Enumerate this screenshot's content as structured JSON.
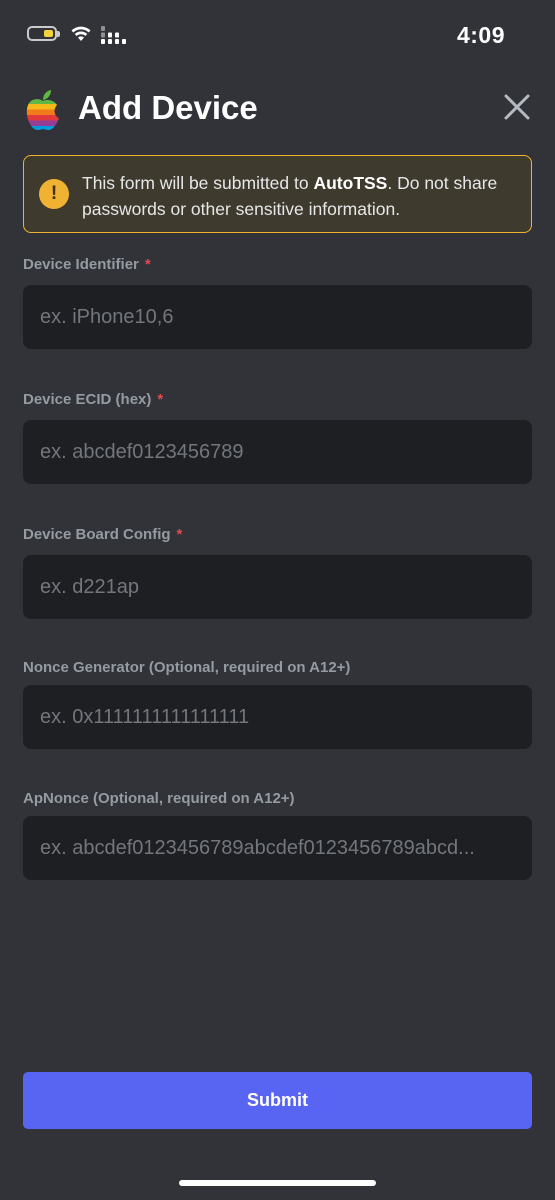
{
  "status_bar": {
    "time": "4:09",
    "battery_color": "#f2d33b"
  },
  "header": {
    "title": "Add Device",
    "logo_icon": "apple-rainbow-logo",
    "close_icon": "close-icon"
  },
  "warning": {
    "text_before": "This form will be submitted to ",
    "text_bold": "AutoTSS",
    "text_after": ". Do not share passwords or other sensitive information.",
    "icon": "exclamation-icon",
    "border_color": "#f0b232"
  },
  "fields": [
    {
      "label": "Device Identifier",
      "required_mark": "*",
      "placeholder": "ex. iPhone10,6",
      "value": ""
    },
    {
      "label": "Device ECID (hex)",
      "required_mark": "*",
      "placeholder": "ex. abcdef0123456789",
      "value": ""
    },
    {
      "label": "Device Board Config",
      "required_mark": "*",
      "placeholder": "ex. d221ap",
      "value": ""
    },
    {
      "label": "Nonce Generator (Optional, required on A12+)",
      "placeholder": "ex. 0x1111111111111111",
      "value": ""
    },
    {
      "label": "ApNonce (Optional, required on A12+)",
      "placeholder": "ex. abcdef0123456789abcdef0123456789abcd...",
      "value": ""
    }
  ],
  "submit": {
    "label": "Submit",
    "color": "#5865f2"
  }
}
